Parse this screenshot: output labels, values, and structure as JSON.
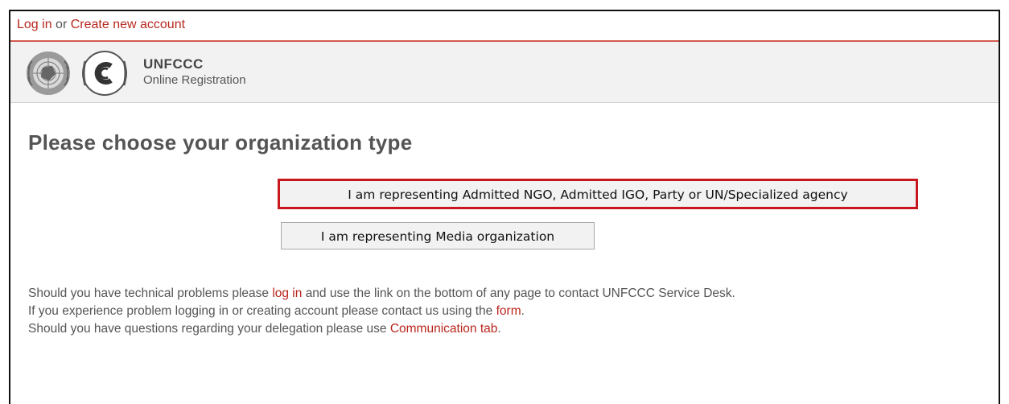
{
  "top_links": {
    "login": "Log in",
    "or": "or",
    "create_account": "Create new account"
  },
  "header": {
    "title": "UNFCCC",
    "subtitle": "Online Registration"
  },
  "main": {
    "heading": "Please choose your organization type",
    "options": [
      "I am representing Admitted NGO, Admitted IGO, Party or UN/Specialized agency",
      "I am representing Media organization"
    ]
  },
  "info": {
    "line1_pre": "Should you have technical problems please",
    "line1_link": "log in",
    "line1_post": "and use the link on the bottom of any page to contact UNFCCC Service Desk.",
    "line2_pre": "If you experience problem logging in or creating account please contact us using the",
    "line2_link": "form",
    "line2_post": ".",
    "line3_pre": "Should you have questions regarding your delegation please use",
    "line3_link": "Communication tab",
    "line3_post": "."
  },
  "colors": {
    "link": "#b8261d",
    "highlight_border": "#c8171d",
    "header_bg": "#f2f2f2"
  },
  "icons": [
    "un-emblem-icon",
    "climate-change-logo-icon"
  ]
}
